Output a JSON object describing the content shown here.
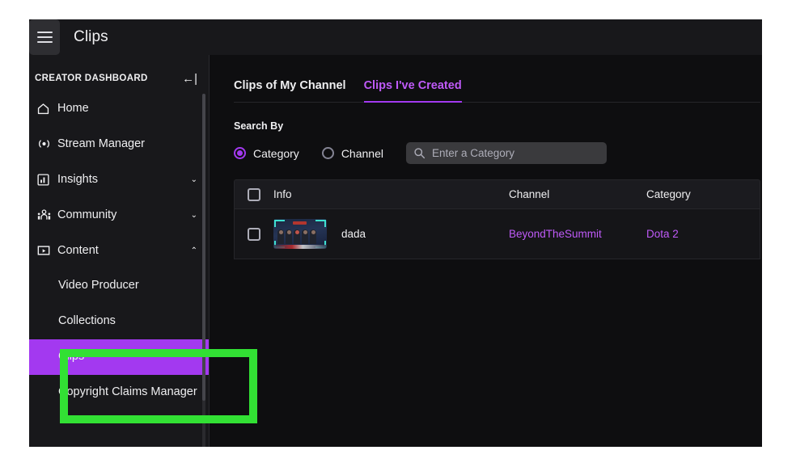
{
  "topbar": {
    "menu_icon": "hamburger-icon",
    "title": "Clips"
  },
  "sidebar": {
    "header_label": "CREATOR DASHBOARD",
    "collapse_icon": "collapse-left-icon",
    "items": [
      {
        "label": "Home",
        "icon": "home-icon",
        "chevron": ""
      },
      {
        "label": "Stream Manager",
        "icon": "broadcast-icon",
        "chevron": ""
      },
      {
        "label": "Insights",
        "icon": "chart-icon",
        "chevron": "⌄"
      },
      {
        "label": "Community",
        "icon": "people-icon",
        "chevron": "⌄"
      },
      {
        "label": "Content",
        "icon": "video-icon",
        "chevron": "⌃"
      }
    ],
    "sub_items": [
      {
        "label": "Video Producer",
        "selected": false
      },
      {
        "label": "Collections",
        "selected": false
      },
      {
        "label": "Clips",
        "selected": true
      },
      {
        "label": "Copyright Claims Manager",
        "selected": false
      }
    ]
  },
  "main": {
    "tabs": [
      {
        "label": "Clips of My Channel",
        "active": false
      },
      {
        "label": "Clips I've Created",
        "active": true
      }
    ],
    "search_by_label": "Search By",
    "radios": [
      {
        "label": "Category",
        "checked": true
      },
      {
        "label": "Channel",
        "checked": false
      }
    ],
    "search": {
      "icon": "search-icon",
      "placeholder": "Enter a Category",
      "value": ""
    },
    "table": {
      "columns": [
        "Info",
        "Channel",
        "Category"
      ],
      "rows": [
        {
          "info": "dada",
          "channel": "BeyondTheSummit",
          "category": "Dota 2",
          "thumbnail": "esports-team-photo-thumbnail"
        }
      ]
    }
  },
  "annotation": {
    "name": "green-highlight-box",
    "color": "#32e034",
    "targets": "Clips"
  },
  "colors": {
    "accent_purple": "#a339f0",
    "link_purple": "#bf5af8",
    "annotation_green": "#32e034",
    "panel_dark": "#18181b",
    "page_dark": "#0e0e10"
  }
}
